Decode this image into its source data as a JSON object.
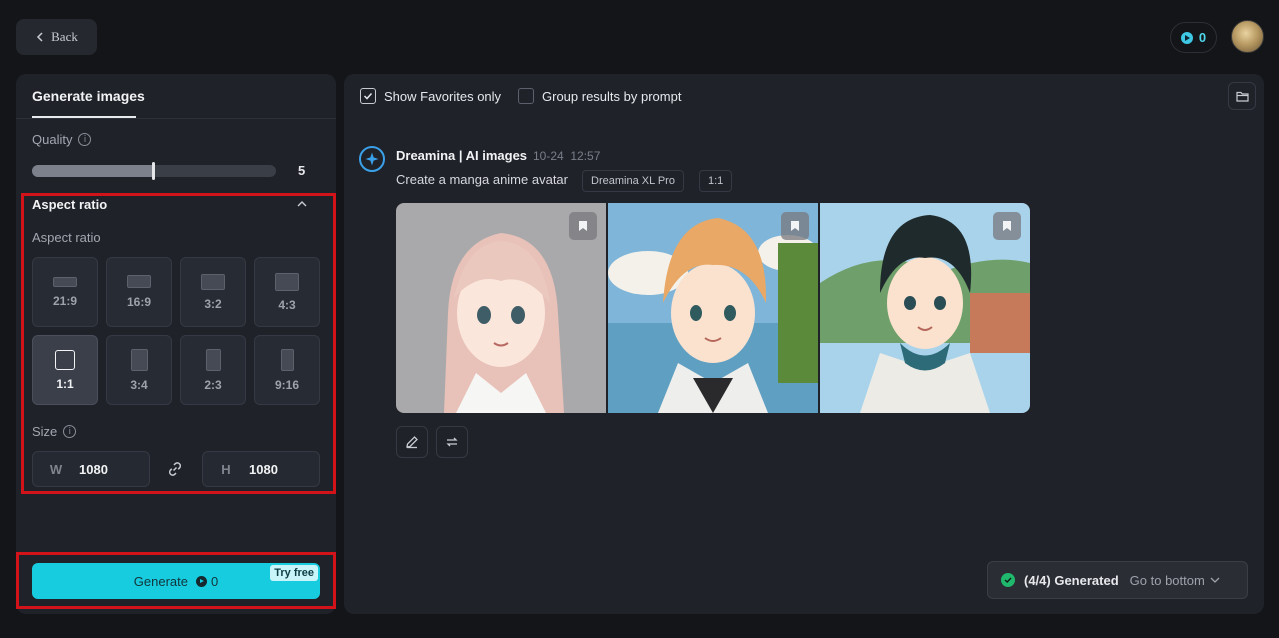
{
  "header": {
    "back_label": "Back",
    "credits": "0"
  },
  "left_panel": {
    "tab_label": "Generate images",
    "quality": {
      "label": "Quality",
      "value": "5",
      "slider_fraction": 0.5
    },
    "aspect_ratio": {
      "heading": "Aspect ratio",
      "sub_label": "Aspect ratio",
      "options": [
        "21:9",
        "16:9",
        "3:2",
        "4:3",
        "1:1",
        "3:4",
        "2:3",
        "9:16"
      ],
      "selected": "1:1"
    },
    "size": {
      "label": "Size",
      "width_prefix": "W",
      "width_value": "1080",
      "height_prefix": "H",
      "height_value": "1080"
    },
    "generate": {
      "label": "Generate",
      "cost": "0",
      "badge": "Try free"
    }
  },
  "main": {
    "show_favorites_label": "Show Favorites only",
    "show_favorites_checked": true,
    "group_by_prompt_label": "Group results by prompt",
    "group_by_prompt_checked": false,
    "result": {
      "bot_name": "Dreamina | AI images",
      "date": "10-24",
      "time": "12:57",
      "prompt": "Create a manga anime avatar",
      "model_tag": "Dreamina XL Pro",
      "ratio_tag": "1:1",
      "images": [
        "anime-girl-pink-hair",
        "anime-boy-orange-hair",
        "anime-boy-dark-hair"
      ]
    },
    "status": {
      "generated_label": "(4/4) Generated",
      "go_to_bottom_label": "Go to bottom"
    }
  },
  "colors": {
    "accent": "#17ccdf",
    "highlight_box": "#d2131a",
    "success": "#1fb86c"
  },
  "icons": [
    "chevron-left-icon",
    "credit-coin-icon",
    "info-icon",
    "chevron-up-icon",
    "link-icon",
    "check-icon",
    "folder-icon",
    "dreamina-logo-icon",
    "bookmark-icon",
    "edit-icon",
    "regenerate-icon",
    "check-circle-icon",
    "chevron-down-icon"
  ]
}
